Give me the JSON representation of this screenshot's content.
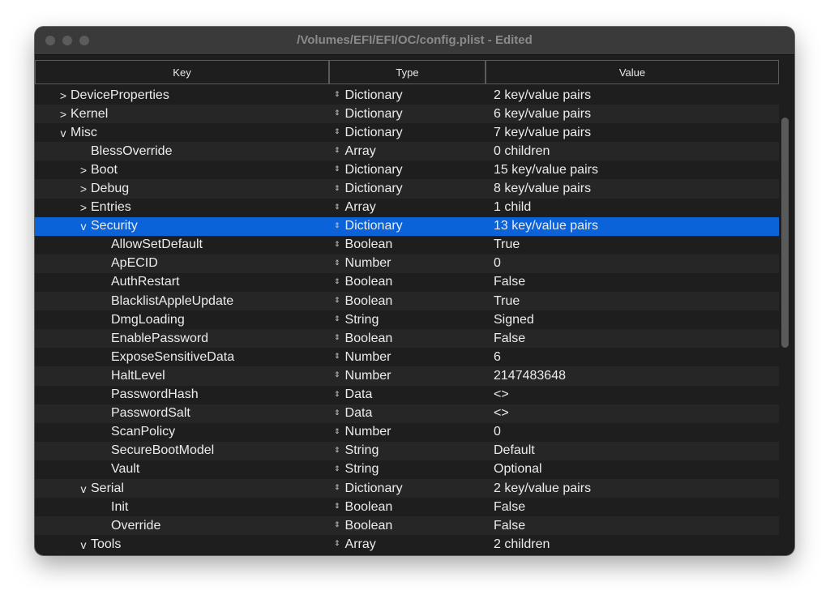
{
  "window": {
    "title": "/Volumes/EFI/EFI/OC/config.plist - Edited"
  },
  "columns": {
    "key": "Key",
    "type": "Type",
    "value": "Value"
  },
  "icons": {
    "collapsed": ">",
    "expanded": "v",
    "type_popup": "⇕"
  },
  "colors": {
    "selection": "#0a63d8",
    "background": "#1e1e1e",
    "alt_row": "#262626",
    "text": "#ececec"
  },
  "rows": [
    {
      "key": "DeviceProperties",
      "depth": 0,
      "disclosure": "collapsed",
      "type": "Dictionary",
      "value": "2 key/value pairs"
    },
    {
      "key": "Kernel",
      "depth": 0,
      "disclosure": "collapsed",
      "type": "Dictionary",
      "value": "6 key/value pairs"
    },
    {
      "key": "Misc",
      "depth": 0,
      "disclosure": "expanded",
      "type": "Dictionary",
      "value": "7 key/value pairs"
    },
    {
      "key": "BlessOverride",
      "depth": 1,
      "disclosure": "none",
      "type": "Array",
      "value": "0 children"
    },
    {
      "key": "Boot",
      "depth": 1,
      "disclosure": "collapsed",
      "type": "Dictionary",
      "value": "15 key/value pairs"
    },
    {
      "key": "Debug",
      "depth": 1,
      "disclosure": "collapsed",
      "type": "Dictionary",
      "value": "8 key/value pairs"
    },
    {
      "key": "Entries",
      "depth": 1,
      "disclosure": "collapsed",
      "type": "Array",
      "value": "1 child"
    },
    {
      "key": "Security",
      "depth": 1,
      "disclosure": "expanded",
      "type": "Dictionary",
      "value": "13 key/value pairs",
      "selected": true
    },
    {
      "key": "AllowSetDefault",
      "depth": 2,
      "disclosure": "none",
      "type": "Boolean",
      "value": "True"
    },
    {
      "key": "ApECID",
      "depth": 2,
      "disclosure": "none",
      "type": "Number",
      "value": "0"
    },
    {
      "key": "AuthRestart",
      "depth": 2,
      "disclosure": "none",
      "type": "Boolean",
      "value": "False"
    },
    {
      "key": "BlacklistAppleUpdate",
      "depth": 2,
      "disclosure": "none",
      "type": "Boolean",
      "value": "True"
    },
    {
      "key": "DmgLoading",
      "depth": 2,
      "disclosure": "none",
      "type": "String",
      "value": "Signed"
    },
    {
      "key": "EnablePassword",
      "depth": 2,
      "disclosure": "none",
      "type": "Boolean",
      "value": "False"
    },
    {
      "key": "ExposeSensitiveData",
      "depth": 2,
      "disclosure": "none",
      "type": "Number",
      "value": "6"
    },
    {
      "key": "HaltLevel",
      "depth": 2,
      "disclosure": "none",
      "type": "Number",
      "value": "2147483648"
    },
    {
      "key": "PasswordHash",
      "depth": 2,
      "disclosure": "none",
      "type": "Data",
      "value": "<>"
    },
    {
      "key": "PasswordSalt",
      "depth": 2,
      "disclosure": "none",
      "type": "Data",
      "value": "<>"
    },
    {
      "key": "ScanPolicy",
      "depth": 2,
      "disclosure": "none",
      "type": "Number",
      "value": "0"
    },
    {
      "key": "SecureBootModel",
      "depth": 2,
      "disclosure": "none",
      "type": "String",
      "value": "Default"
    },
    {
      "key": "Vault",
      "depth": 2,
      "disclosure": "none",
      "type": "String",
      "value": "Optional"
    },
    {
      "key": "Serial",
      "depth": 1,
      "disclosure": "expanded",
      "type": "Dictionary",
      "value": "2 key/value pairs"
    },
    {
      "key": "Init",
      "depth": 2,
      "disclosure": "none",
      "type": "Boolean",
      "value": "False"
    },
    {
      "key": "Override",
      "depth": 2,
      "disclosure": "none",
      "type": "Boolean",
      "value": "False"
    },
    {
      "key": "Tools",
      "depth": 1,
      "disclosure": "expanded",
      "type": "Array",
      "value": "2 children"
    }
  ]
}
